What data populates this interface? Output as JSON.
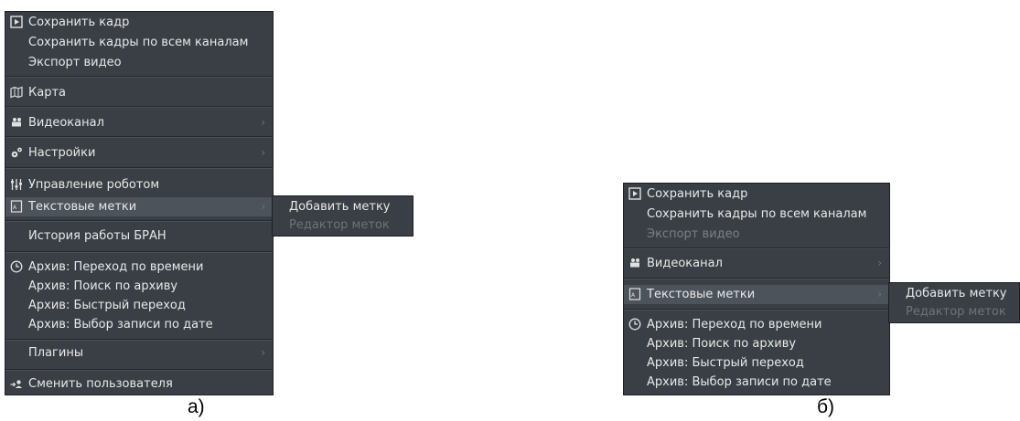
{
  "menu_a": {
    "save_frame": "Сохранить кадр",
    "save_frames_all": "Сохранить кадры по всем каналам",
    "export_video": "Экспорт видео",
    "map": "Карта",
    "video_channel": "Видеоканал",
    "settings": "Настройки",
    "robot_control": "Управление роботом",
    "text_marks": "Текстовые метки",
    "history": "История работы БРАН",
    "archive_time": "Архив: Переход по времени",
    "archive_search": "Архив: Поиск по архиву",
    "archive_fast": "Архив: Быстрый переход",
    "archive_date": "Архив: Выбор записи по дате",
    "plugins": "Плагины",
    "change_user": "Сменить пользователя",
    "arrow": "›"
  },
  "submenu_a": {
    "add_mark": "Добавить метку",
    "mark_editor": "Редактор меток"
  },
  "menu_b": {
    "save_frame": "Сохранить кадр",
    "save_frames_all": "Сохранить кадры по всем каналам",
    "export_video": "Экспорт видео",
    "video_channel": "Видеоканал",
    "text_marks": "Текстовые метки",
    "archive_time": "Архив: Переход по времени",
    "archive_search": "Архив: Поиск по архиву",
    "archive_fast": "Архив: Быстрый переход",
    "archive_date": "Архив: Выбор записи по дате",
    "arrow": "›"
  },
  "submenu_b": {
    "add_mark": "Добавить метку",
    "mark_editor": "Редактор меток"
  },
  "captions": {
    "a": "а)",
    "b": "б)"
  },
  "colors": {
    "menu_bg": "#3a3f45",
    "highlight": "#4c535b",
    "text": "#e8e8e8",
    "disabled": "#7a7f86"
  }
}
